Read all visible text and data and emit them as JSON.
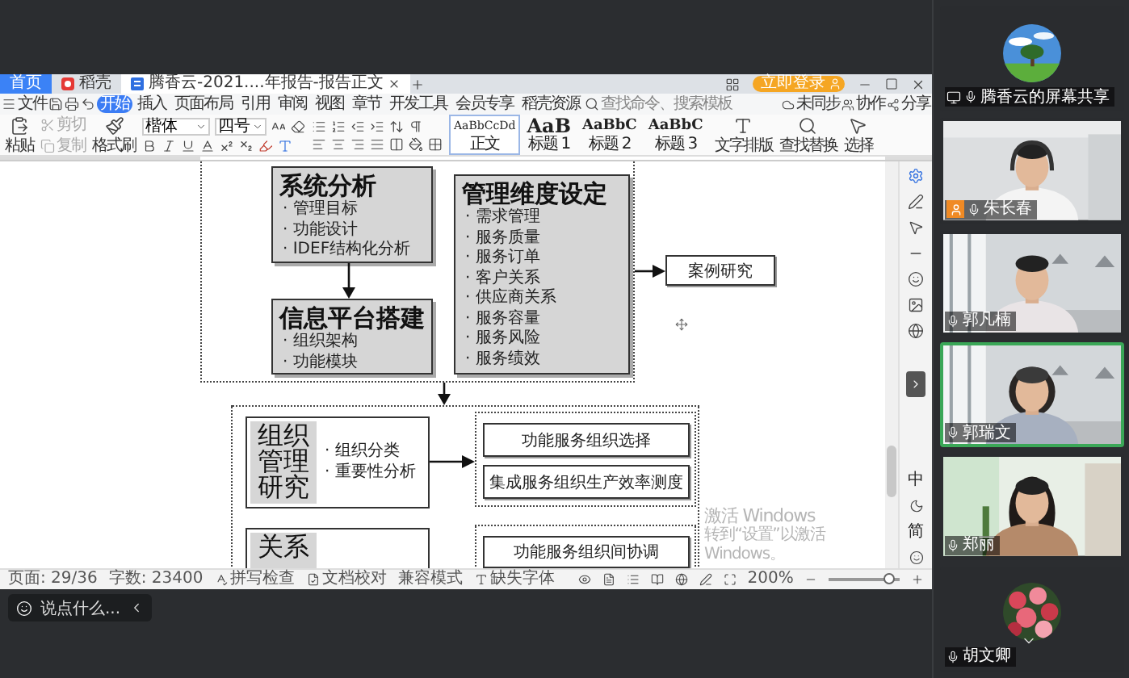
{
  "app_tabs": [
    {
      "label": "首页",
      "kind": "home",
      "selected": false
    },
    {
      "label": "稻壳",
      "kind": "store",
      "selected": false
    },
    {
      "label": "腾香云-2021....年报告-报告正文",
      "kind": "document",
      "selected": true
    }
  ],
  "login_button": "立即登录",
  "file_menu": "文件",
  "menu": [
    {
      "label": "开始",
      "selected": true
    },
    {
      "label": "插入",
      "selected": false
    },
    {
      "label": "页面布局",
      "selected": false
    },
    {
      "label": "引用",
      "selected": false
    },
    {
      "label": "审阅",
      "selected": false
    },
    {
      "label": "视图",
      "selected": false
    },
    {
      "label": "章节",
      "selected": false
    },
    {
      "label": "开发工具",
      "selected": false
    },
    {
      "label": "会员专享",
      "selected": false
    },
    {
      "label": "稻壳资源",
      "selected": false
    }
  ],
  "search": {
    "placeholder": "查找命令、搜索模板"
  },
  "menu_actions": [
    "未同步",
    "协作",
    "分享"
  ],
  "ribbon": {
    "clipboard": [
      {
        "label": "粘贴",
        "kind": "big",
        "disabled": false
      },
      {
        "label": "剪切",
        "kind": "small",
        "disabled": true
      },
      {
        "label": "复制",
        "kind": "small",
        "disabled": true
      },
      {
        "label": "格式刷",
        "kind": "big",
        "disabled": false
      }
    ],
    "font": {
      "family": "楷体",
      "size": "四号"
    },
    "styles": [
      {
        "sample": "AaBbCcDd",
        "label": "正文",
        "selected": true
      },
      {
        "sample": "AaB",
        "label": "标题 1",
        "selected": false
      },
      {
        "sample": "AaBbC",
        "label": "标题 2",
        "selected": false
      },
      {
        "sample": "AaBbC",
        "label": "标题 3",
        "selected": false
      }
    ],
    "tools": [
      "文字排版",
      "查找替换",
      "选择"
    ]
  },
  "diagram": {
    "analysis": {
      "title": "系统分析",
      "bullets": [
        "· 管理目标",
        "· 功能设计",
        "· IDEF结构化分析"
      ]
    },
    "platform": {
      "title": "信息平台搭建",
      "bullets": [
        "· 组织架构",
        "· 功能模块"
      ]
    },
    "dimensions": {
      "title": "管理维度设定",
      "bullets": [
        "· 需求管理",
        "· 服务质量",
        "· 服务订单",
        "· 客户关系",
        "· 供应商关系",
        "· 服务容量",
        "· 服务风险",
        "· 服务绩效"
      ]
    },
    "case_study": "案例研究",
    "org_research": {
      "title": "组织管理研究",
      "bullets": [
        "· 组织分类",
        "· 重要性分析"
      ],
      "outcomes": [
        "功能服务组织选择",
        "集成服务组织生产效率测度"
      ]
    },
    "relation": {
      "title": "关系",
      "outcomes": [
        "功能服务组织间协调"
      ]
    }
  },
  "watermark": {
    "title": "激活 Windows",
    "subtitle": "转到“设置”以激活 Windows。"
  },
  "ime": [
    "中",
    "简"
  ],
  "status_bar": {
    "items": [
      "页面: 29/36",
      "字数: 23400",
      "拼写检查",
      "文档校对",
      "兼容模式",
      "缺失字体"
    ],
    "zoom": "200%",
    "zoom_slider": {
      "level": 0.85
    }
  },
  "chat_button": "说点什么...",
  "meeting_tiles": [
    {
      "kind": "avatar",
      "name": "腾香云的屏幕共享",
      "sharing": true,
      "host": false,
      "speaking": false
    },
    {
      "kind": "camera",
      "name": "朱长春",
      "sharing": false,
      "host": true,
      "speaking": false
    },
    {
      "kind": "camera",
      "name": "郭凡楠",
      "sharing": false,
      "host": false,
      "speaking": false
    },
    {
      "kind": "camera",
      "name": "郭瑞文",
      "sharing": false,
      "host": false,
      "speaking": true
    },
    {
      "kind": "camera",
      "name": "郑丽",
      "sharing": false,
      "host": false,
      "speaking": false
    },
    {
      "kind": "avatar",
      "name": "胡文卿",
      "sharing": false,
      "host": false,
      "speaking": false
    }
  ]
}
